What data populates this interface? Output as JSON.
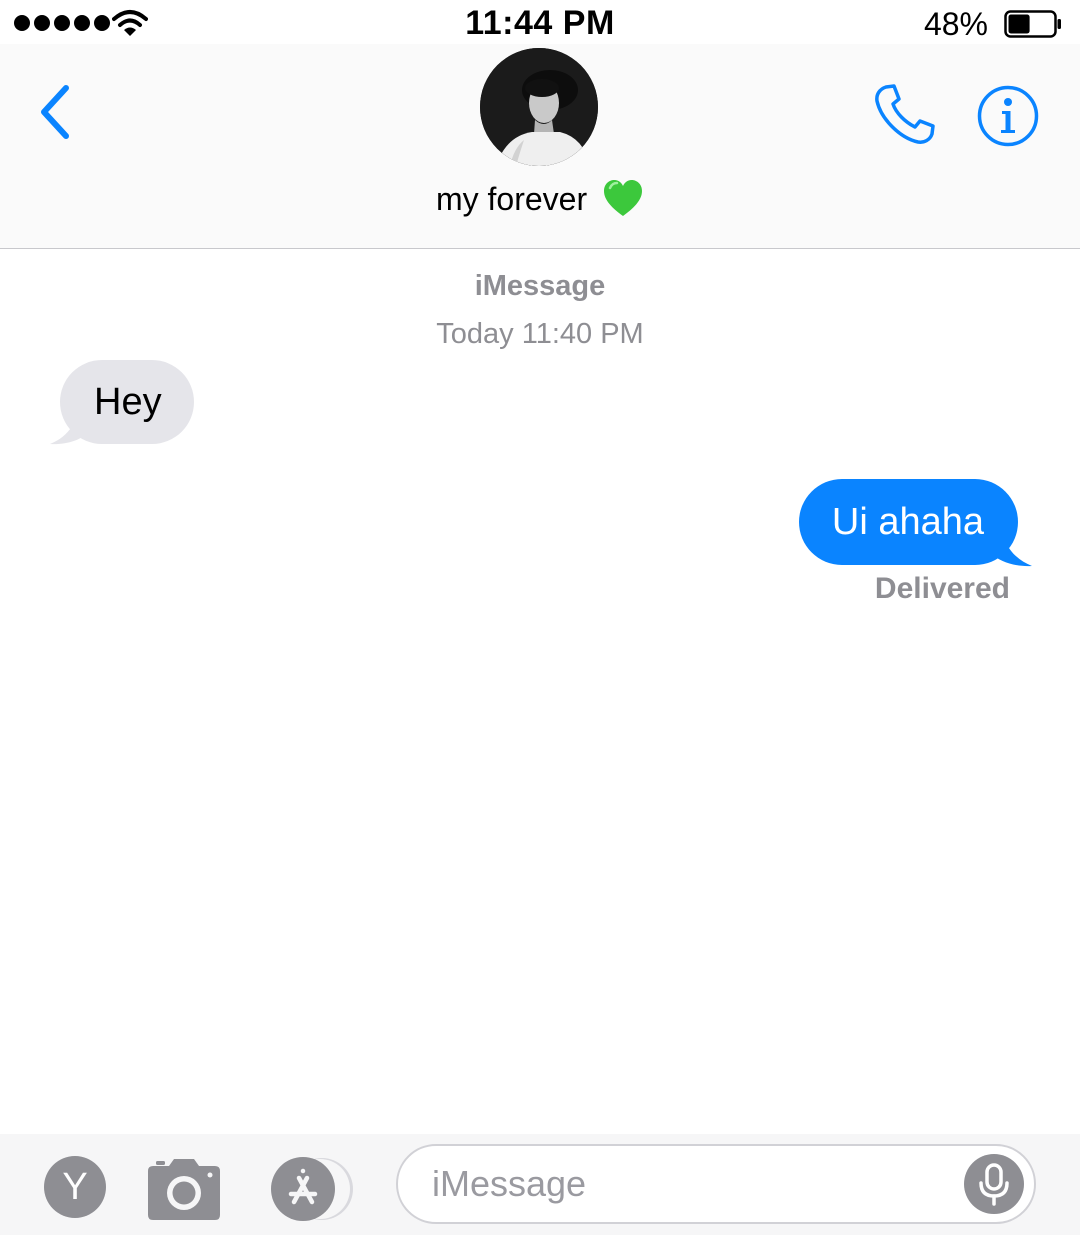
{
  "status_bar": {
    "time": "11:44 PM",
    "battery_percent": "48%",
    "battery_level": 0.48,
    "signal_bars": 5
  },
  "header": {
    "contact_name": "my forever",
    "contact_emoji": "green-heart"
  },
  "conversation": {
    "service": "iMessage",
    "timestamp": "Today 11:40 PM",
    "messages": [
      {
        "direction": "incoming",
        "text": "Hey"
      },
      {
        "direction": "outgoing",
        "text": "Ui ahaha",
        "status": "Delivered"
      }
    ]
  },
  "input_bar": {
    "left_avatar_letter": "Y",
    "placeholder": "iMessage"
  },
  "colors": {
    "accent": "#0a84ff",
    "incoming_bubble": "#e5e5ea",
    "secondary_text": "#8e8e93",
    "heart": "#3cc83c"
  }
}
